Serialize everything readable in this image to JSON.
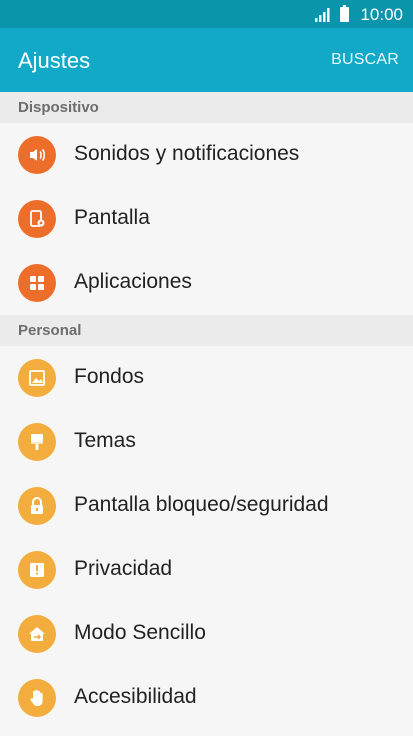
{
  "status": {
    "time": "10:00"
  },
  "header": {
    "title": "Ajustes",
    "action": "BUSCAR"
  },
  "sections": [
    {
      "title": "Dispositivo",
      "items": [
        {
          "label": "Sonidos y notificaciones",
          "icon": "speaker-icon",
          "color": "#ed6d2a"
        },
        {
          "label": "Pantalla",
          "icon": "display-settings-icon",
          "color": "#ed6d2a"
        },
        {
          "label": "Aplicaciones",
          "icon": "apps-grid-icon",
          "color": "#ed6d2a"
        }
      ]
    },
    {
      "title": "Personal",
      "items": [
        {
          "label": "Fondos",
          "icon": "wallpaper-icon",
          "color": "#f2ad3d"
        },
        {
          "label": "Temas",
          "icon": "brush-icon",
          "color": "#f2ad3d"
        },
        {
          "label": "Pantalla bloqueo/seguridad",
          "icon": "lock-icon",
          "color": "#f2ad3d"
        },
        {
          "label": "Privacidad",
          "icon": "privacy-icon",
          "color": "#f2ad3d"
        },
        {
          "label": "Modo Sencillo",
          "icon": "easy-mode-icon",
          "color": "#f2ad3d"
        },
        {
          "label": "Accesibilidad",
          "icon": "hand-icon",
          "color": "#f2ad3d"
        }
      ]
    }
  ]
}
